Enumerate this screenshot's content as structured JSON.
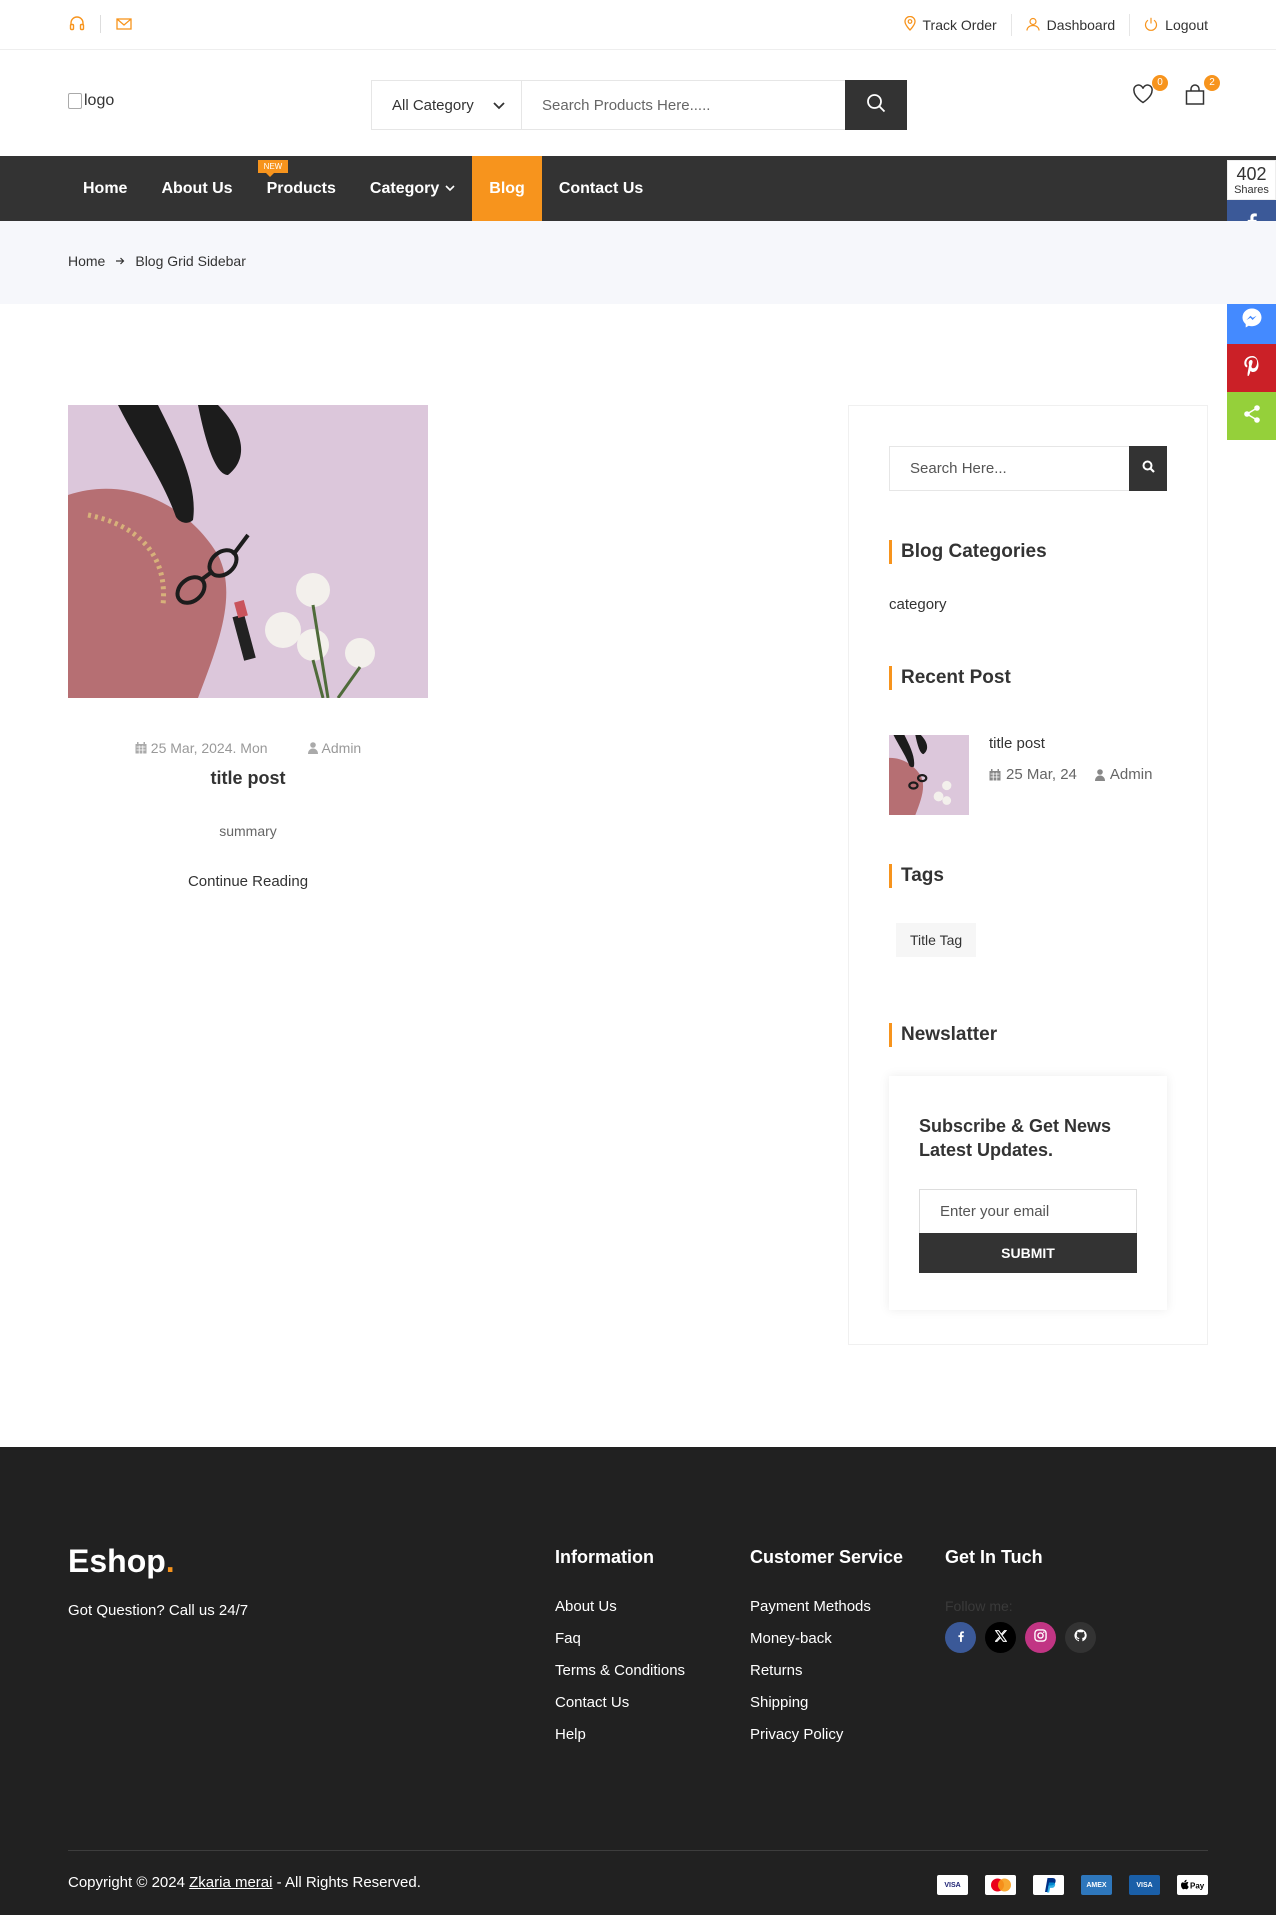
{
  "topbar": {
    "track_order": "Track Order",
    "dashboard": "Dashboard",
    "logout": "Logout"
  },
  "header": {
    "logo_alt": "logo",
    "category_select": "All Category",
    "search_placeholder": "Search Products Here.....",
    "wishlist_count": "0",
    "cart_count": "2"
  },
  "nav": {
    "items": [
      {
        "label": "Home"
      },
      {
        "label": "About Us"
      },
      {
        "label": "Products",
        "badge": "NEW"
      },
      {
        "label": "Category"
      },
      {
        "label": "Blog",
        "active": true
      },
      {
        "label": "Contact Us"
      }
    ]
  },
  "share": {
    "count": "402",
    "label": "Shares"
  },
  "breadcrumb": {
    "home": "Home",
    "current": "Blog Grid Sidebar"
  },
  "post": {
    "date": "25 Mar, 2024. Mon",
    "author": "Admin",
    "title": "title post",
    "summary": "summary",
    "continue": "Continue Reading"
  },
  "sidebar": {
    "search_placeholder": "Search Here...",
    "categories_heading": "Blog Categories",
    "category_item": "category",
    "recent_heading": "Recent Post",
    "recent_post": {
      "title": "title post",
      "date": "25 Mar, 24",
      "author": "Admin"
    },
    "tags_heading": "Tags",
    "tag": "Title Tag",
    "newsletter_heading": "Newslatter",
    "newsletter_title": "Subscribe & Get News Latest Updates.",
    "email_placeholder": "Enter your email",
    "submit": "SUBMIT"
  },
  "footer": {
    "brand": "Eshop",
    "brand_dot": ".",
    "question": "Got Question? Call us 24/7",
    "information": {
      "heading": "Information",
      "links": [
        "About Us",
        "Faq",
        "Terms & Conditions",
        "Contact Us",
        "Help"
      ]
    },
    "customer_service": {
      "heading": "Customer Service",
      "links": [
        "Payment Methods",
        "Money-back",
        "Returns",
        "Shipping",
        "Privacy Policy"
      ]
    },
    "get_in_touch": {
      "heading": "Get In Tuch",
      "follow": "Follow me:"
    },
    "copyright_prefix": "Copyright © 2024 ",
    "copyright_name": "Zkaria merai",
    "copyright_suffix": " - All Rights Reserved.",
    "payment_icons": [
      "visa",
      "mastercard",
      "paypal",
      "amex",
      "visa-electron",
      "apple-pay"
    ]
  },
  "colors": {
    "accent": "#f7941d",
    "dark": "#333333",
    "footer_bg": "#212121",
    "facebook": "#3b5998",
    "twitter": "#000000",
    "messenger": "#448aff",
    "pinterest": "#cb2027",
    "sharethis": "#95d03a"
  }
}
